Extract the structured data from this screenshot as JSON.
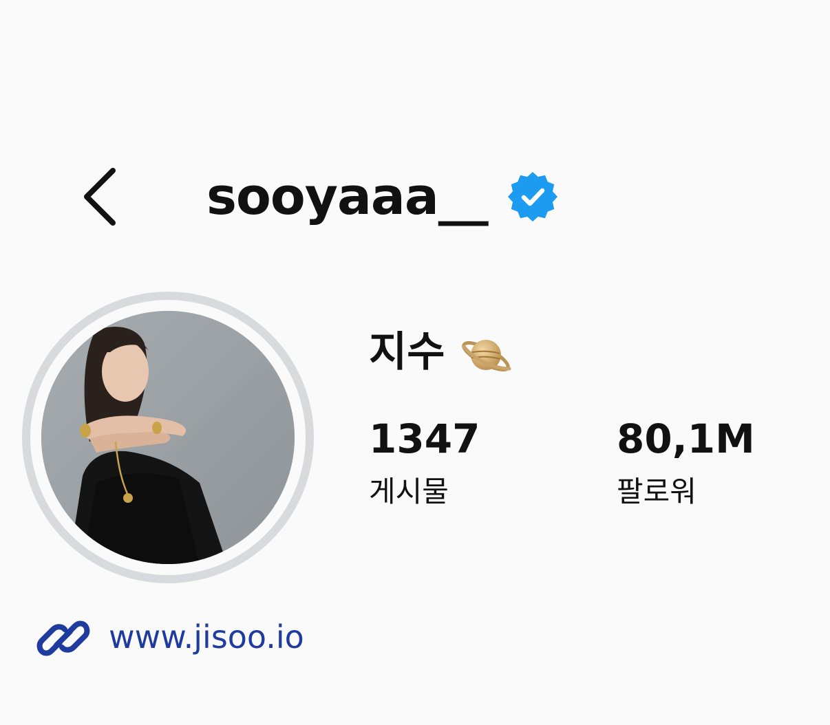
{
  "header": {
    "back_icon": "chevron-left-icon",
    "username": "sooyaaa__",
    "verified_icon": "verified-badge-icon",
    "verified_color": "#1d9bf0"
  },
  "profile": {
    "display_name": "지수",
    "display_name_emoji": "saturn-planet-icon",
    "avatar_icon": "profile-photo"
  },
  "stats": {
    "posts": {
      "value": "1347",
      "label": "게시물"
    },
    "followers": {
      "value": "80,1M",
      "label": "팔로워"
    }
  },
  "website": {
    "icon": "link-icon",
    "url": "www.jisoo.io",
    "color": "#1f3b9e"
  }
}
